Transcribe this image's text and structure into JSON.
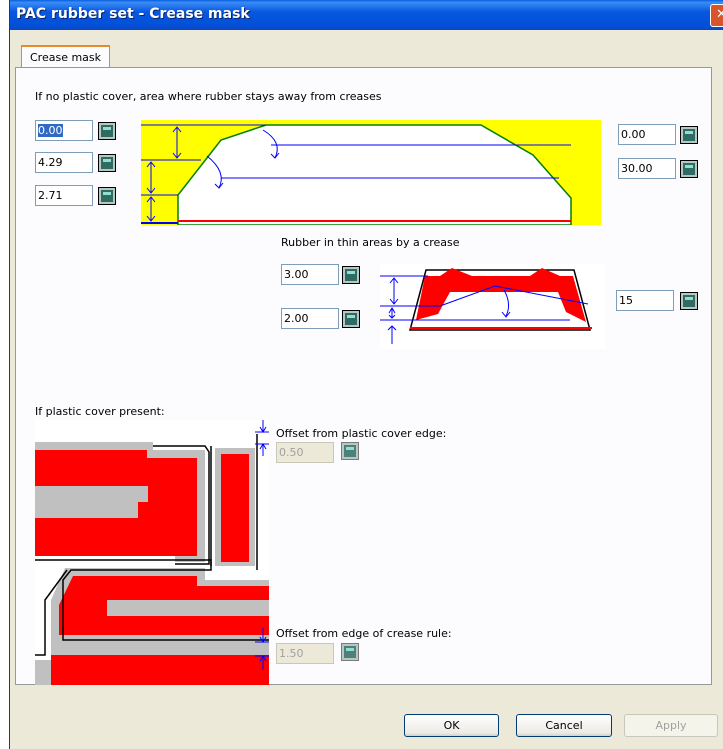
{
  "window": {
    "title": "PAC rubber set - Crease mask",
    "close_glyph": "✕"
  },
  "tabs": [
    {
      "label": "Crease mask"
    }
  ],
  "no_cover": {
    "heading": "If no plastic cover, area where rubber stays away from creases",
    "left_values": [
      "0.00",
      "4.29",
      "2.71"
    ],
    "right_values": [
      "0.00",
      "30.00"
    ]
  },
  "thin": {
    "heading": "Rubber in thin areas by a crease",
    "values": [
      "3.00",
      "2.00"
    ],
    "angle": "15"
  },
  "cover": {
    "heading": "If plastic cover present:",
    "edge_label": "Offset from plastic cover edge:",
    "edge_value": "0.50",
    "rule_label": "Offset from edge of crease rule:",
    "rule_value": "1.50"
  },
  "buttons": {
    "ok": "OK",
    "cancel": "Cancel",
    "apply": "Apply"
  },
  "icons": {
    "calc": "calculator-icon",
    "close": "close-icon"
  },
  "colors": {
    "rubber": "#ff0000",
    "yellow_area": "#ffff00",
    "guide_line": "#0000ff",
    "crease_outline": "#008000"
  }
}
